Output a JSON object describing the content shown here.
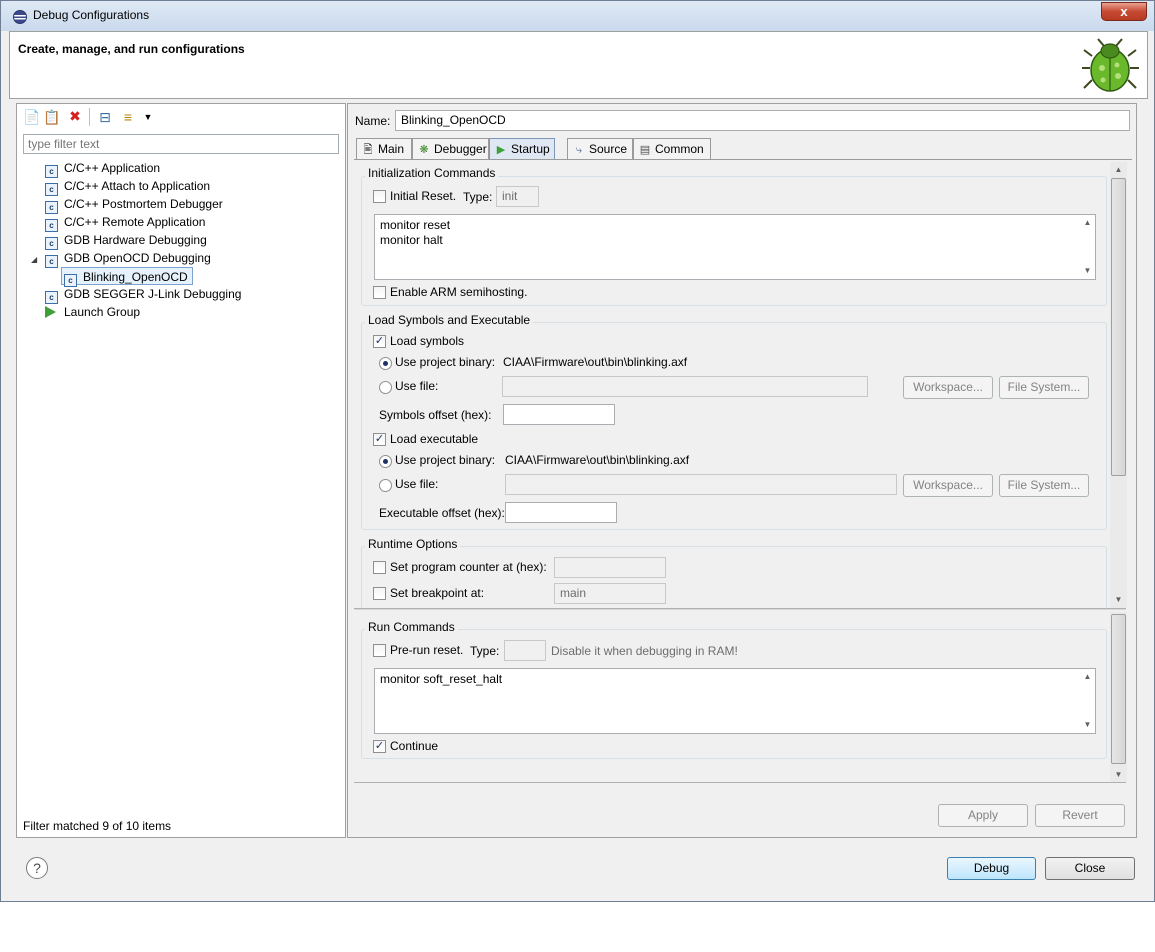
{
  "window": {
    "title": "Debug Configurations",
    "close_glyph": "x"
  },
  "header": {
    "title": "Create, manage, and run configurations"
  },
  "left": {
    "filter_placeholder": "type filter text",
    "tree": [
      {
        "label": "C/C++ Application"
      },
      {
        "label": "C/C++ Attach to Application"
      },
      {
        "label": "C/C++ Postmortem Debugger"
      },
      {
        "label": "C/C++ Remote Application"
      },
      {
        "label": "GDB Hardware Debugging"
      },
      {
        "label": "GDB OpenOCD Debugging",
        "expanded": true
      },
      {
        "label": "Blinking_OpenOCD",
        "selected": true
      },
      {
        "label": "GDB SEGGER J-Link Debugging"
      },
      {
        "label": "Launch Group"
      }
    ],
    "status": "Filter matched 9 of 10 items",
    "icon_letter": "c"
  },
  "right": {
    "name_label": "Name:",
    "name_value": "Blinking_OpenOCD",
    "tabs": [
      {
        "label": "Main"
      },
      {
        "label": "Debugger"
      },
      {
        "label": "Startup",
        "active": true
      },
      {
        "label": "Source"
      },
      {
        "label": "Common"
      }
    ],
    "init": {
      "legend": "Initialization Commands",
      "initial_reset_label": "Initial Reset.",
      "type_label": "Type:",
      "type_value": "init",
      "commands": "monitor reset\nmonitor halt",
      "semihosting_label": "Enable ARM semihosting."
    },
    "load": {
      "legend": "Load Symbols and Executable",
      "load_symbols_label": "Load symbols",
      "use_project_binary_label": "Use project binary:",
      "symbols_binary": "CIAA\\Firmware\\out\\bin\\blinking.axf",
      "use_file_label": "Use file:",
      "workspace_label": "Workspace...",
      "filesystem_label": "File System...",
      "symbols_offset_label": "Symbols offset (hex):",
      "load_executable_label": "Load executable",
      "executable_binary": "CIAA\\Firmware\\out\\bin\\blinking.axf",
      "executable_offset_label": "Executable offset (hex):"
    },
    "runtime": {
      "legend": "Runtime Options",
      "set_pc_label": "Set program counter at (hex):",
      "set_bp_label": "Set breakpoint at:",
      "bp_value": "main"
    },
    "run": {
      "legend": "Run Commands",
      "pre_run_label": "Pre-run reset.",
      "type_label": "Type:",
      "hint": "Disable it when debugging in RAM!",
      "commands": "monitor soft_reset_halt",
      "continue_label": "Continue"
    },
    "apply_label": "Apply",
    "revert_label": "Revert"
  },
  "footer": {
    "help_glyph": "?",
    "debug_label": "Debug",
    "close_label": "Close"
  }
}
